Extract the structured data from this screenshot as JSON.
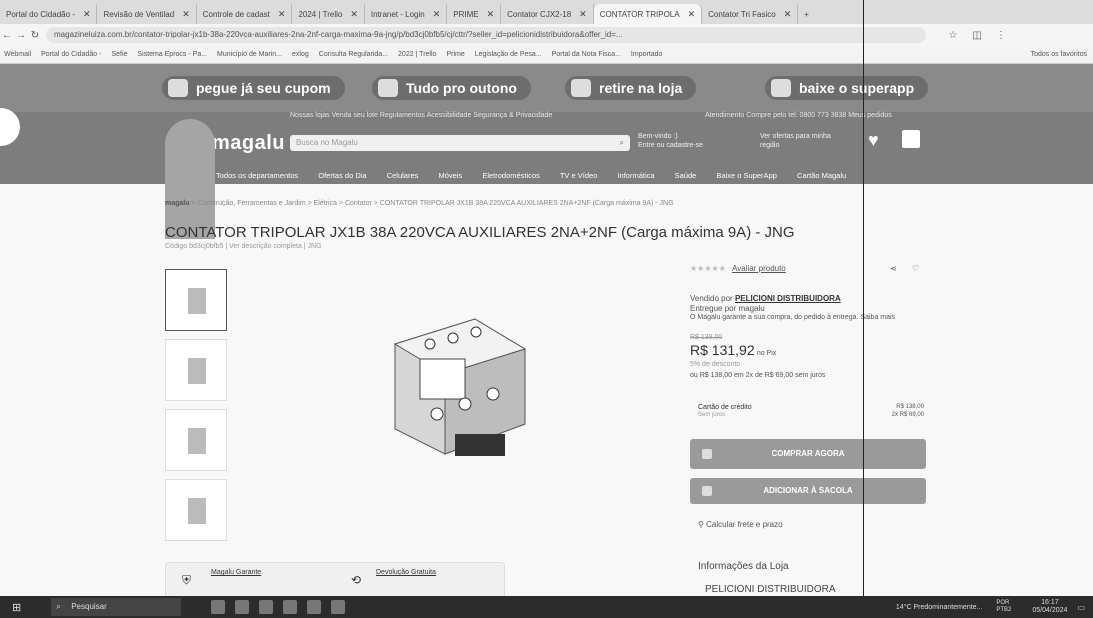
{
  "browser": {
    "tabs": [
      {
        "label": "Portal do Cidadão -",
        "active": false
      },
      {
        "label": "Revisão de Ventilad",
        "active": false
      },
      {
        "label": "Controle de cadast",
        "active": false
      },
      {
        "label": "2024 | Trello",
        "active": false
      },
      {
        "label": "Intranet - Login",
        "active": false
      },
      {
        "label": "PRIME",
        "active": false
      },
      {
        "label": "Contator CJX2-18",
        "active": false
      },
      {
        "label": "CONTATOR TRIPOLA",
        "active": true
      },
      {
        "label": "Contator Tri Fasico",
        "active": false
      }
    ],
    "url": "magazineluiza.com.br/contator-tripolar-jx1b-38a-220vca-auxiliares-2na-2nf-carga-maxima-9a-jng/p/bd3cj0bfb5/cj/cttr/?seller_id=pelicionidistribuidora&offer_id=...",
    "bookmarks": [
      "Webmail",
      "Portal do Cidadão -",
      "Sefie",
      "Sistema Eprocs - Pa...",
      "Município de Marin...",
      "exlog",
      "Consulta Regularida...",
      "2022 | Trello",
      "Prime",
      "Legislação de Pesa...",
      "Portal da Nota Fisca...",
      "Importado",
      "Todos os favoritos"
    ]
  },
  "promo": {
    "items": [
      "pegue já seu cupom",
      "Tudo pro outono",
      "retire na loja",
      "baixe o superapp"
    ]
  },
  "header": {
    "toplinks_left": "Nossas lojas   Venda seu lote   Regulamentos   Acessibilidade   Segurança & Privacidade",
    "toplinks_right": "Atendimento   Compre pelo tel: 0800 773 3838   Meus pedidos",
    "logo": "magalu",
    "search_placeholder": "Busca no Magalu",
    "login_line1": "Bem-vindo :)",
    "login_line2": "Entre ou cadastre-se",
    "cep_line1": "Ver ofertas para minha",
    "cep_line2": "região"
  },
  "nav": {
    "items": [
      "Todos os departamentos",
      "Ofertas do Dia",
      "Celulares",
      "Móveis",
      "Eletrodomésticos",
      "TV e Vídeo",
      "Informática",
      "Saúde",
      "Baixe o SuperApp",
      "Cartão Magalu"
    ]
  },
  "breadcrumb": {
    "home": "magalu",
    "rest": "> Construção, Ferramentas e Jardim > Elétrica > Contator > CONTATOR TRIPOLAR JX1B 38A 220VCA AUXILIARES 2NA+2NF (Carga máxima 9A) - JNG"
  },
  "product": {
    "title": "CONTATOR TRIPOLAR JX1B 38A 220VCA AUXILIARES 2NA+2NF (Carga máxima 9A) - JNG",
    "subtitle": "Código bd3cj0bfb5 | Ver descrição completa | JNG",
    "rating_link": "Avaliar produto",
    "sold_by_label": "Vendido por",
    "seller": "PELICIONI DISTRIBUIDORA",
    "delivered_by": "Entregue por magalu",
    "guarantee_note": "O Magalu garante a sua compra, do pedido à entrega. Saiba mais",
    "old_price": "R$ 138,00",
    "price": "R$ 131,92",
    "price_method": "no Pix",
    "discount": "5% de desconto",
    "installments": "ou R$ 138,00 em 2x de R$ 69,00 sem juros",
    "card_label": "Cartão de crédito",
    "card_sub": "Sem juros",
    "card_price_1": "R$ 138,00",
    "card_price_2": "2x R$ 69,00",
    "buy_now": "COMPRAR AGORA",
    "add_to_bag": "ADICIONAR À SACOLA",
    "shipping": "Calcular frete e prazo",
    "store_info_title": "Informações da Loja",
    "store_name": "PELICIONI DISTRIBUIDORA",
    "guarantee_label": "Magalu Garante",
    "free_return_label": "Devolução Gratuita"
  },
  "taskbar": {
    "search_label": "Pesquisar",
    "weather": "14°C Predominantemente...",
    "lang": "POR PTB2",
    "time": "16:17",
    "date": "05/04/2024"
  }
}
